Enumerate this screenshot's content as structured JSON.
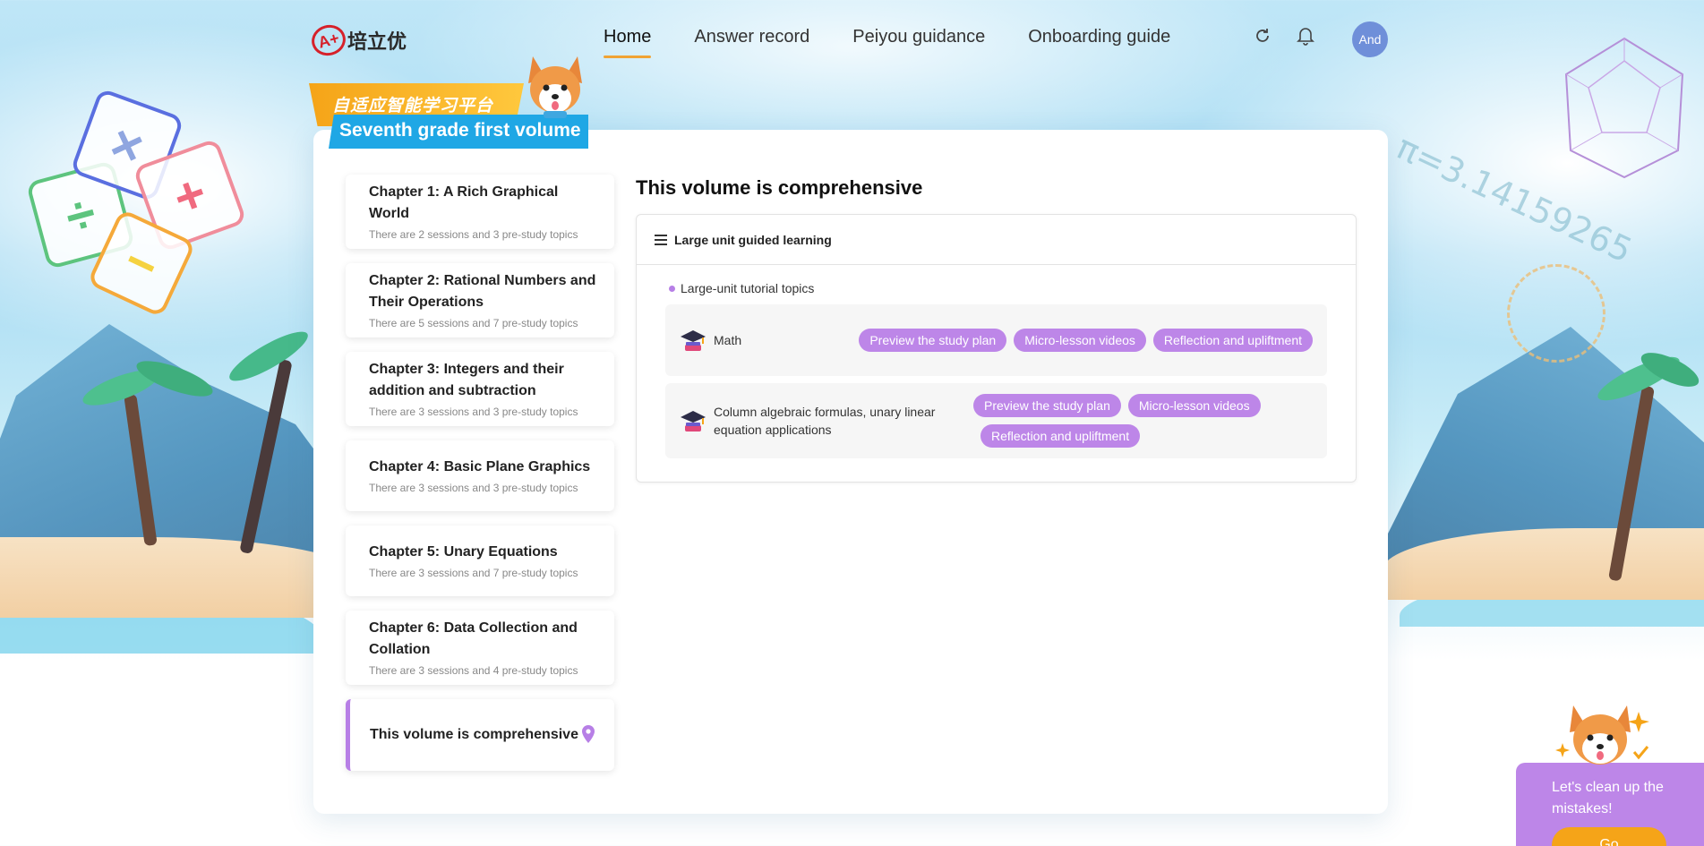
{
  "header": {
    "logo_text": "培立优",
    "logo_mark": "A+",
    "nav": [
      {
        "label": "Home",
        "active": true
      },
      {
        "label": "Answer record",
        "active": false
      },
      {
        "label": "Peiyou guidance",
        "active": false
      },
      {
        "label": "Onboarding guide",
        "active": false
      }
    ],
    "icons": [
      "refresh-icon",
      "bell-icon"
    ],
    "avatar_label": "And"
  },
  "banner": {
    "platform": "自适应智能学习平台",
    "grade": "Seventh grade  first volume"
  },
  "chapters": [
    {
      "title": "Chapter 1: A Rich Graphical World",
      "sub": "There are 2 sessions and 3 pre-study topics"
    },
    {
      "title": "Chapter 2: Rational Numbers and Their Operations",
      "sub": "There are 5 sessions and 7 pre-study topics"
    },
    {
      "title": "Chapter 3: Integers and their addition and subtraction",
      "sub": "There are 3 sessions and 3 pre-study topics"
    },
    {
      "title": "Chapter 4: Basic Plane Graphics",
      "sub": "There are 3 sessions and 3 pre-study topics"
    },
    {
      "title": "Chapter 5: Unary Equations",
      "sub": "There are 3 sessions and 7 pre-study topics"
    },
    {
      "title": "Chapter 6: Data Collection and Collation",
      "sub": "There are 3 sessions and 4 pre-study topics"
    }
  ],
  "active_chapter": {
    "title": "This volume is comprehensive"
  },
  "content": {
    "title": "This volume is comprehensive",
    "unit_header": "Large unit guided learning",
    "topics_label": "Large-unit tutorial topics",
    "topics": [
      {
        "name": "Math",
        "tags": [
          "Preview the study plan",
          "Micro-lesson videos",
          "Reflection and upliftment"
        ]
      },
      {
        "name": "Column algebraic formulas, unary linear equation applications",
        "tags": [
          "Preview the study plan",
          "Micro-lesson videos",
          "Reflection and upliftment"
        ]
      }
    ]
  },
  "mistakes_widget": {
    "text": "Let's clean up the mistakes!",
    "button": "Go"
  },
  "decor": {
    "pi_text": "π=3.14159265",
    "accent_purple": "#bd86e8",
    "accent_orange": "#f0a334"
  }
}
